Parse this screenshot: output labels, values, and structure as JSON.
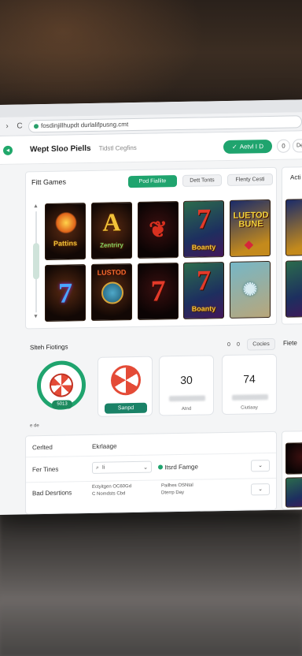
{
  "browser": {
    "url": "fosdinjillhupdt durlalifpusng.cmt"
  },
  "header": {
    "title": "Wept Sloo Piells",
    "subtitle": "Tidstl Cegfins",
    "primary_button": "Aetvl I D",
    "round_button": "0",
    "edge_button": "De"
  },
  "games": {
    "title": "Fitt Games",
    "filters": [
      "Pod Fiallite",
      "Dett Tonts",
      "Flenty Cesti"
    ],
    "side_filter": "Acti",
    "tiles": [
      {
        "text": "Pattins",
        "style": "dark",
        "icon": "sun-icon"
      },
      {
        "text": "Zentriry",
        "style": "dark",
        "icon": "letter-a-icon"
      },
      {
        "text": "",
        "style": "red",
        "icon": "red-leaves-icon"
      },
      {
        "text": "Boanty",
        "style": "purple",
        "icon": "lucky-seven-icon"
      },
      {
        "text": "LUETOD BUNE",
        "style": "gold",
        "icon": "gem-icon"
      },
      {
        "text": "",
        "style": "dark",
        "icon": "blue-seven-icon"
      },
      {
        "text": "LUSTOD",
        "style": "dark",
        "icon": "globe-icon"
      },
      {
        "text": "",
        "style": "red",
        "icon": "red-seven-icon"
      },
      {
        "text": "Boanty",
        "style": "purple",
        "icon": "lucky-seven-icon"
      },
      {
        "text": "",
        "style": "light",
        "icon": "crystal-icon"
      }
    ]
  },
  "stats": {
    "title": "Slteh Fiotings",
    "controls": [
      "0",
      "0",
      "Cocies"
    ],
    "side_title": "Fiete",
    "card1_badge": "5013",
    "card2_button": "Sanpd",
    "card3_value": "30",
    "card3_label": "Atnd",
    "card4_value": "74",
    "card4_label": "Ciutiaay",
    "footnote": "e de"
  },
  "filters": {
    "col1": "Cerlted",
    "col2": "Ekrlaage",
    "row1_label": "Fer Tines",
    "search_value": "Ii",
    "checkbox_label": "Itsrd Famge",
    "row2_label": "Bad Desrtions",
    "list1": [
      "Ectyitgen OC60Gd",
      "C Nomdsts Cbd"
    ],
    "list2": [
      "Pailhes OSNtal",
      "Dterrp Day"
    ]
  }
}
